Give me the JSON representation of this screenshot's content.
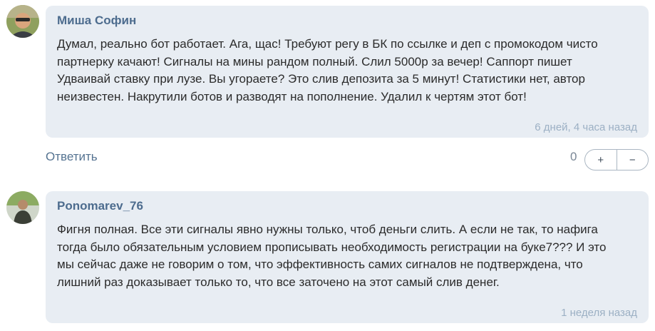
{
  "comments": [
    {
      "author": "Миша Софин",
      "text": "Думал, реально бот работает. Ага, щас! Требуют регу в БК по ссылке и деп с промокодом чисто партнерку качают! Сигналы на мины рандом полный. Слил 5000р за вечер! Саппорт пишет Удваивай ставку при лузе. Вы угораете? Это слив депозита за 5 минут! Статистики нет, автор неизвестен. Накрутили ботов и разводят на пополнение. Удалил к чертям этот бот!",
      "time": "6 дней, 4 часа назад",
      "reply_label": "Ответить",
      "score": "0",
      "upvote": "+",
      "downvote": "−"
    },
    {
      "author": "Ponomarev_76",
      "text": "Фигня полная. Все эти сигналы явно нужны только, чтоб деньги слить. А если не так, то нафига тогда было обязательным условием прописывать необходимость регистрации на буке7??? И это мы сейчас даже не говорим о том, что эффективность самих сигналов не подтверждена, что лишний раз доказывает только то, что все заточено на этот самый слив денег.",
      "time": "1 неделя назад"
    }
  ],
  "colors": {
    "bubble_bg": "#e8edf3",
    "author": "#4d6c8e",
    "text": "#2b2b2b",
    "timestamp": "#9cb0c4",
    "reply_link": "#557391"
  }
}
